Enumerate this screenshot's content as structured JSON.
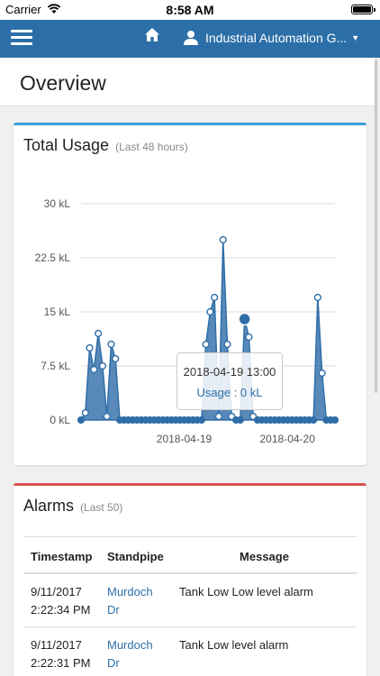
{
  "status_bar": {
    "carrier": "Carrier",
    "time": "8:58 AM"
  },
  "navbar": {
    "account_label": "Industrial Automation G..."
  },
  "page": {
    "title": "Overview"
  },
  "usage": {
    "title": "Total Usage",
    "subtitle": "(Last 48 hours)"
  },
  "tooltip": {
    "date": "2018-04-19 13:00",
    "value": "Usage : 0 kL"
  },
  "chart_data": {
    "type": "area",
    "title": "Total Usage",
    "subtitle": "(Last 48 hours)",
    "ylim": [
      0,
      30
    ],
    "y_ticks": [
      "0 kL",
      "7.5 kL",
      "15 kL",
      "22.5 kL",
      "30 kL"
    ],
    "x_tick_labels": [
      "2018-04-19",
      "2018-04-20"
    ],
    "grid": true,
    "unit": "kL",
    "values": [
      0,
      1,
      10,
      7,
      12,
      7.5,
      0.5,
      10.5,
      8.5,
      0,
      0,
      0,
      0,
      0,
      0,
      0,
      0,
      0,
      0,
      0,
      0,
      0,
      0,
      0,
      0,
      0,
      0,
      0,
      0,
      10.5,
      15,
      17,
      0.5,
      25,
      10.5,
      0.5,
      0,
      0,
      14,
      11.5,
      0.5,
      0,
      0,
      0,
      0,
      0,
      0,
      0,
      0,
      0,
      0,
      0,
      0,
      0,
      0,
      17,
      6.5,
      0,
      0,
      0
    ],
    "highlight_index": 38,
    "highlight_label": "2018-04-19 13:00",
    "highlight_value": 0
  },
  "alarms": {
    "title": "Alarms",
    "subtitle": "(Last 50)",
    "columns": [
      "Timestamp",
      "Standpipe",
      "Message"
    ],
    "rows": [
      {
        "date": "9/11/2017",
        "time": "2:22:34 PM",
        "standpipe_1": "Murdoch",
        "standpipe_2": "Dr",
        "message": "Tank Low Low level alarm"
      },
      {
        "date": "9/11/2017",
        "time": "2:22:31 PM",
        "standpipe_1": "Murdoch",
        "standpipe_2": "Dr",
        "message": "Tank Low level alarm"
      }
    ]
  }
}
